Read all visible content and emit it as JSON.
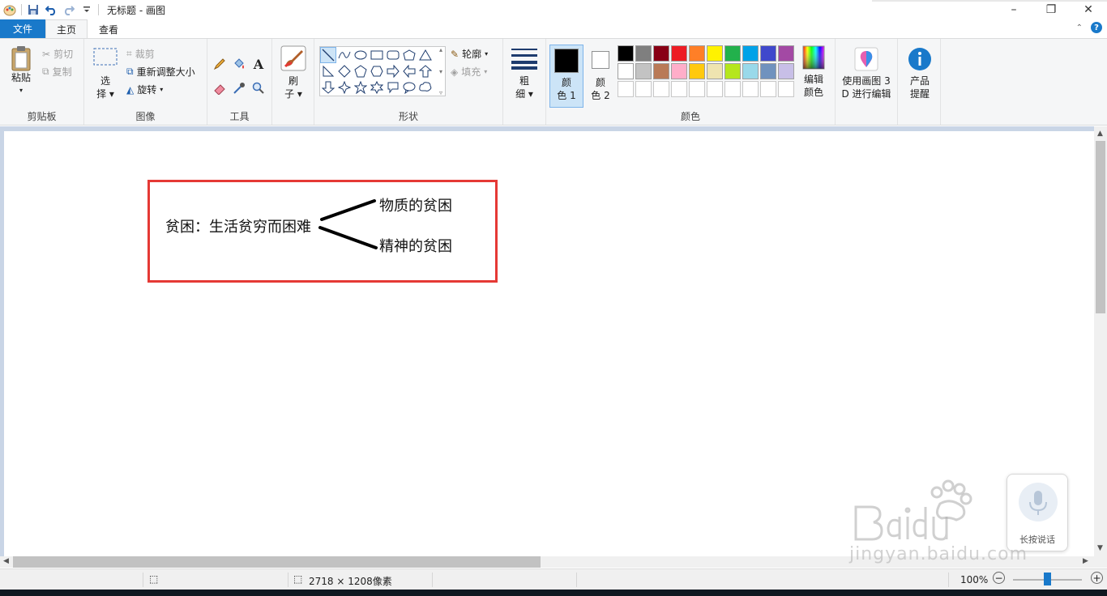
{
  "window": {
    "title": "无标题 - 画图",
    "controls": [
      "–",
      "❐",
      "✕"
    ]
  },
  "tabs": {
    "file": "文件",
    "home": "主页",
    "view": "查看"
  },
  "ribbon": {
    "clipboard": {
      "label": "剪贴板",
      "paste": "粘贴",
      "cut": "剪切",
      "copy": "复制"
    },
    "image": {
      "label": "图像",
      "select_line1": "选",
      "select_line2": "择",
      "crop": "裁剪",
      "resize": "重新调整大小",
      "rotate": "旋转"
    },
    "tools": {
      "label": "工具"
    },
    "brushes": {
      "line1": "刷",
      "line2": "子"
    },
    "shapes": {
      "label": "形状",
      "outline": "轮廓",
      "fill": "填充"
    },
    "size": {
      "line1": "粗",
      "line2": "细"
    },
    "colors": {
      "label": "颜色",
      "color1_line1": "颜",
      "color1_line2": "色 1",
      "color2_line1": "颜",
      "color2_line2": "色 2",
      "edit_line1": "编辑",
      "edit_line2": "颜色",
      "color1": "#000000",
      "color2": "#ffffff",
      "palette": [
        "#000000",
        "#7f7f7f",
        "#880015",
        "#ed1c24",
        "#ff7f27",
        "#fff200",
        "#22b14c",
        "#00a2e8",
        "#3f48cc",
        "#a349a4",
        "#ffffff",
        "#c3c3c3",
        "#b97a57",
        "#ffaec9",
        "#ffc90e",
        "#efe4b0",
        "#b5e61d",
        "#99d9ea",
        "#7092be",
        "#c8bfe7",
        "#ffffff",
        "#ffffff",
        "#ffffff",
        "#ffffff",
        "#ffffff",
        "#ffffff",
        "#ffffff",
        "#ffffff",
        "#ffffff",
        "#ffffff"
      ]
    },
    "paint3d": {
      "line1": "使用画图 3",
      "line2": "D 进行编辑"
    },
    "product": {
      "line1": "产品",
      "line2": "提醒"
    }
  },
  "canvas": {
    "main_text": "贫困：生活贫穷而困难",
    "branch_top": "物质的贫困",
    "branch_bottom": "精神的贫困"
  },
  "status": {
    "dimensions": "2718 × 1208像素",
    "zoom": "100%"
  },
  "overlay": {
    "voice_label": "长按说话",
    "watermark_url": "jingyan.baidu.com"
  }
}
